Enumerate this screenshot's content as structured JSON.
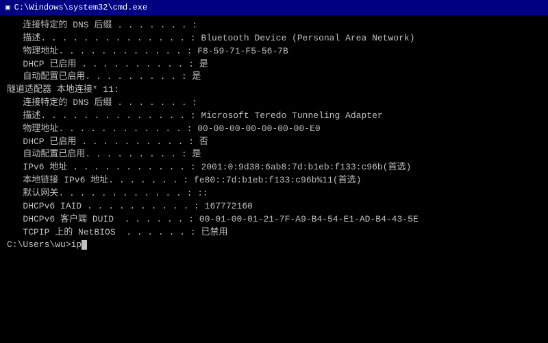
{
  "titleBar": {
    "icon": "▣",
    "text": "C:\\Windows\\system32\\cmd.exe"
  },
  "terminal": {
    "lines": [
      "   连接特定的 DNS 后缀 . . . . . . . :",
      "   描述. . . . . . . . . . . . . . : Bluetooth Device (Personal Area Network)",
      "   物理地址. . . . . . . . . . . . : F8-59-71-F5-56-7B",
      "   DHCP 已启用 . . . . . . . . . . : 是",
      "   自动配置已启用. . . . . . . . . : 是",
      "",
      "隧道适配器 本地连接* 11:",
      "",
      "   连接特定的 DNS 后缀 . . . . . . . :",
      "   描述. . . . . . . . . . . . . . : Microsoft Teredo Tunneling Adapter",
      "   物理地址. . . . . . . . . . . . : 00-00-00-00-00-00-00-E0",
      "   DHCP 已启用 . . . . . . . . . . : 否",
      "   自动配置已启用. . . . . . . . . : 是",
      "   IPv6 地址 . . . . . . . . . . . : 2001:0:9d38:6ab8:7d:b1eb:f133:c96b(首选)",
      "   本地链接 IPv6 地址. . . . . . . : fe80::7d:b1eb:f133:c96b%11(首选)",
      "   默认网关. . . . . . . . . . . . : ::",
      "   DHCPv6 IAID . . . . . . . . . . : 167772160",
      "   DHCPv6 客户端 DUID  . . . . . . : 00-01-00-01-21-7F-A9-B4-54-E1-AD-B4-43-5E",
      "   TCPIP 上的 NetBIOS  . . . . . . : 已禁用",
      "",
      "C:\\Users\\wu>ip"
    ],
    "prompt": "C:\\Users\\wu>ip"
  }
}
